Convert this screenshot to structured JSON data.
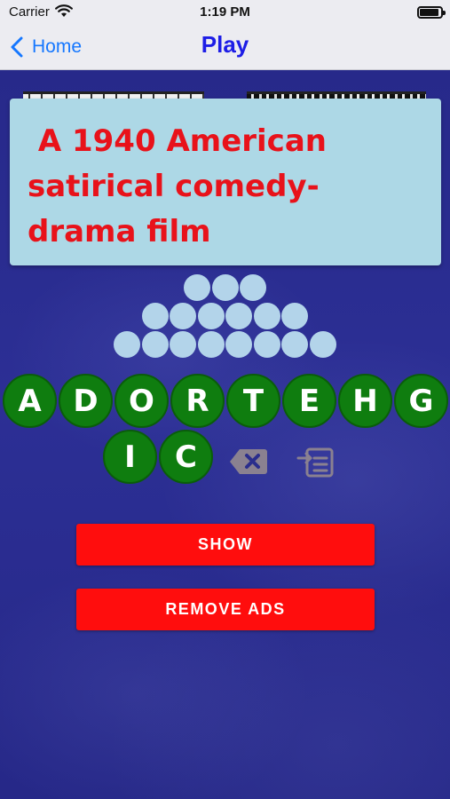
{
  "status_bar": {
    "carrier": "Carrier",
    "time": "1:19 PM"
  },
  "nav": {
    "back_label": "Home",
    "title": "Play"
  },
  "clue": {
    "text": " A 1940 American\nsatirical comedy-\ndrama film"
  },
  "answer": {
    "word_lengths": [
      3,
      6,
      8
    ]
  },
  "letters": {
    "row1": [
      "A",
      "D",
      "O",
      "R",
      "T",
      "E",
      "H",
      "G"
    ],
    "row2": [
      "I",
      "C"
    ]
  },
  "buttons": {
    "show": "SHOW",
    "remove_ads": "REMOVE ADS"
  },
  "colors": {
    "accent_blue": "#1577ff",
    "title_blue": "#1d1de6",
    "clue_card": "#add8e6",
    "clue_text": "#e8121a",
    "letter_tile": "#0f7d0f",
    "answer_slot": "#b3d4ea",
    "action_button": "#ff0d0d",
    "background": "#2a2d8c"
  },
  "icons": {
    "back": "chevron-left-icon",
    "wifi": "wifi-icon",
    "battery": "battery-icon",
    "delete": "delete-backspace-icon",
    "hint": "hint-insert-icon"
  }
}
